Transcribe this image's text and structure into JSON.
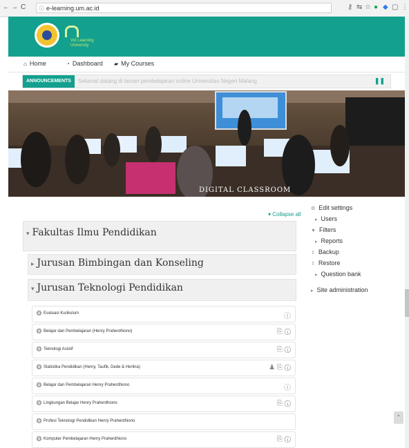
{
  "browser": {
    "url": "e-learning.um.ac.id"
  },
  "site": {
    "brand": "e",
    "brand_sub_line1": "Vid Learning",
    "brand_sub_line2": "University"
  },
  "menu": {
    "home": "Home",
    "dashboard": "Dashboard",
    "my_courses": "My Courses"
  },
  "announcements": {
    "label": "ANNOUNCEMENTS",
    "text": "Selamat datang di laman pembelajaran online Universitas Negeri Malang"
  },
  "hero": {
    "caption": "DIGITAL CLASSROOM"
  },
  "admin_block": {
    "edit_settings": "Edit settings",
    "users": "Users",
    "filters": "Filters",
    "reports": "Reports",
    "backup": "Backup",
    "restore": "Restore",
    "question_bank": "Question bank",
    "site_admin": "Site administration"
  },
  "courses": {
    "collapse_all": "Collapse all",
    "category_1": "Fakultas Ilmu Pendidikan",
    "subcategory_1": "Jurusan Bimbingan dan Konseling",
    "subcategory_2": "Jurusan Teknologi Pendidikan",
    "list": [
      "Evaluasi Kurikulum",
      "Belajar dan Pembelajaran (Henry Praherdhiono)",
      "Teknologi Asistif",
      "Statistika Pendidikan (Henry, Taufik, Dede & Herlina)",
      "Belajar dan Pembelajaran Henry Praherdhiono",
      "Lingkungan Belajar Henry Praherdhiono",
      "Profesi Teknologi Pendidikan Henry Praherdhiono",
      "Komputer Pembelajaran Henry Praherdhiono"
    ]
  },
  "colors": {
    "accent": "#13a08e"
  }
}
